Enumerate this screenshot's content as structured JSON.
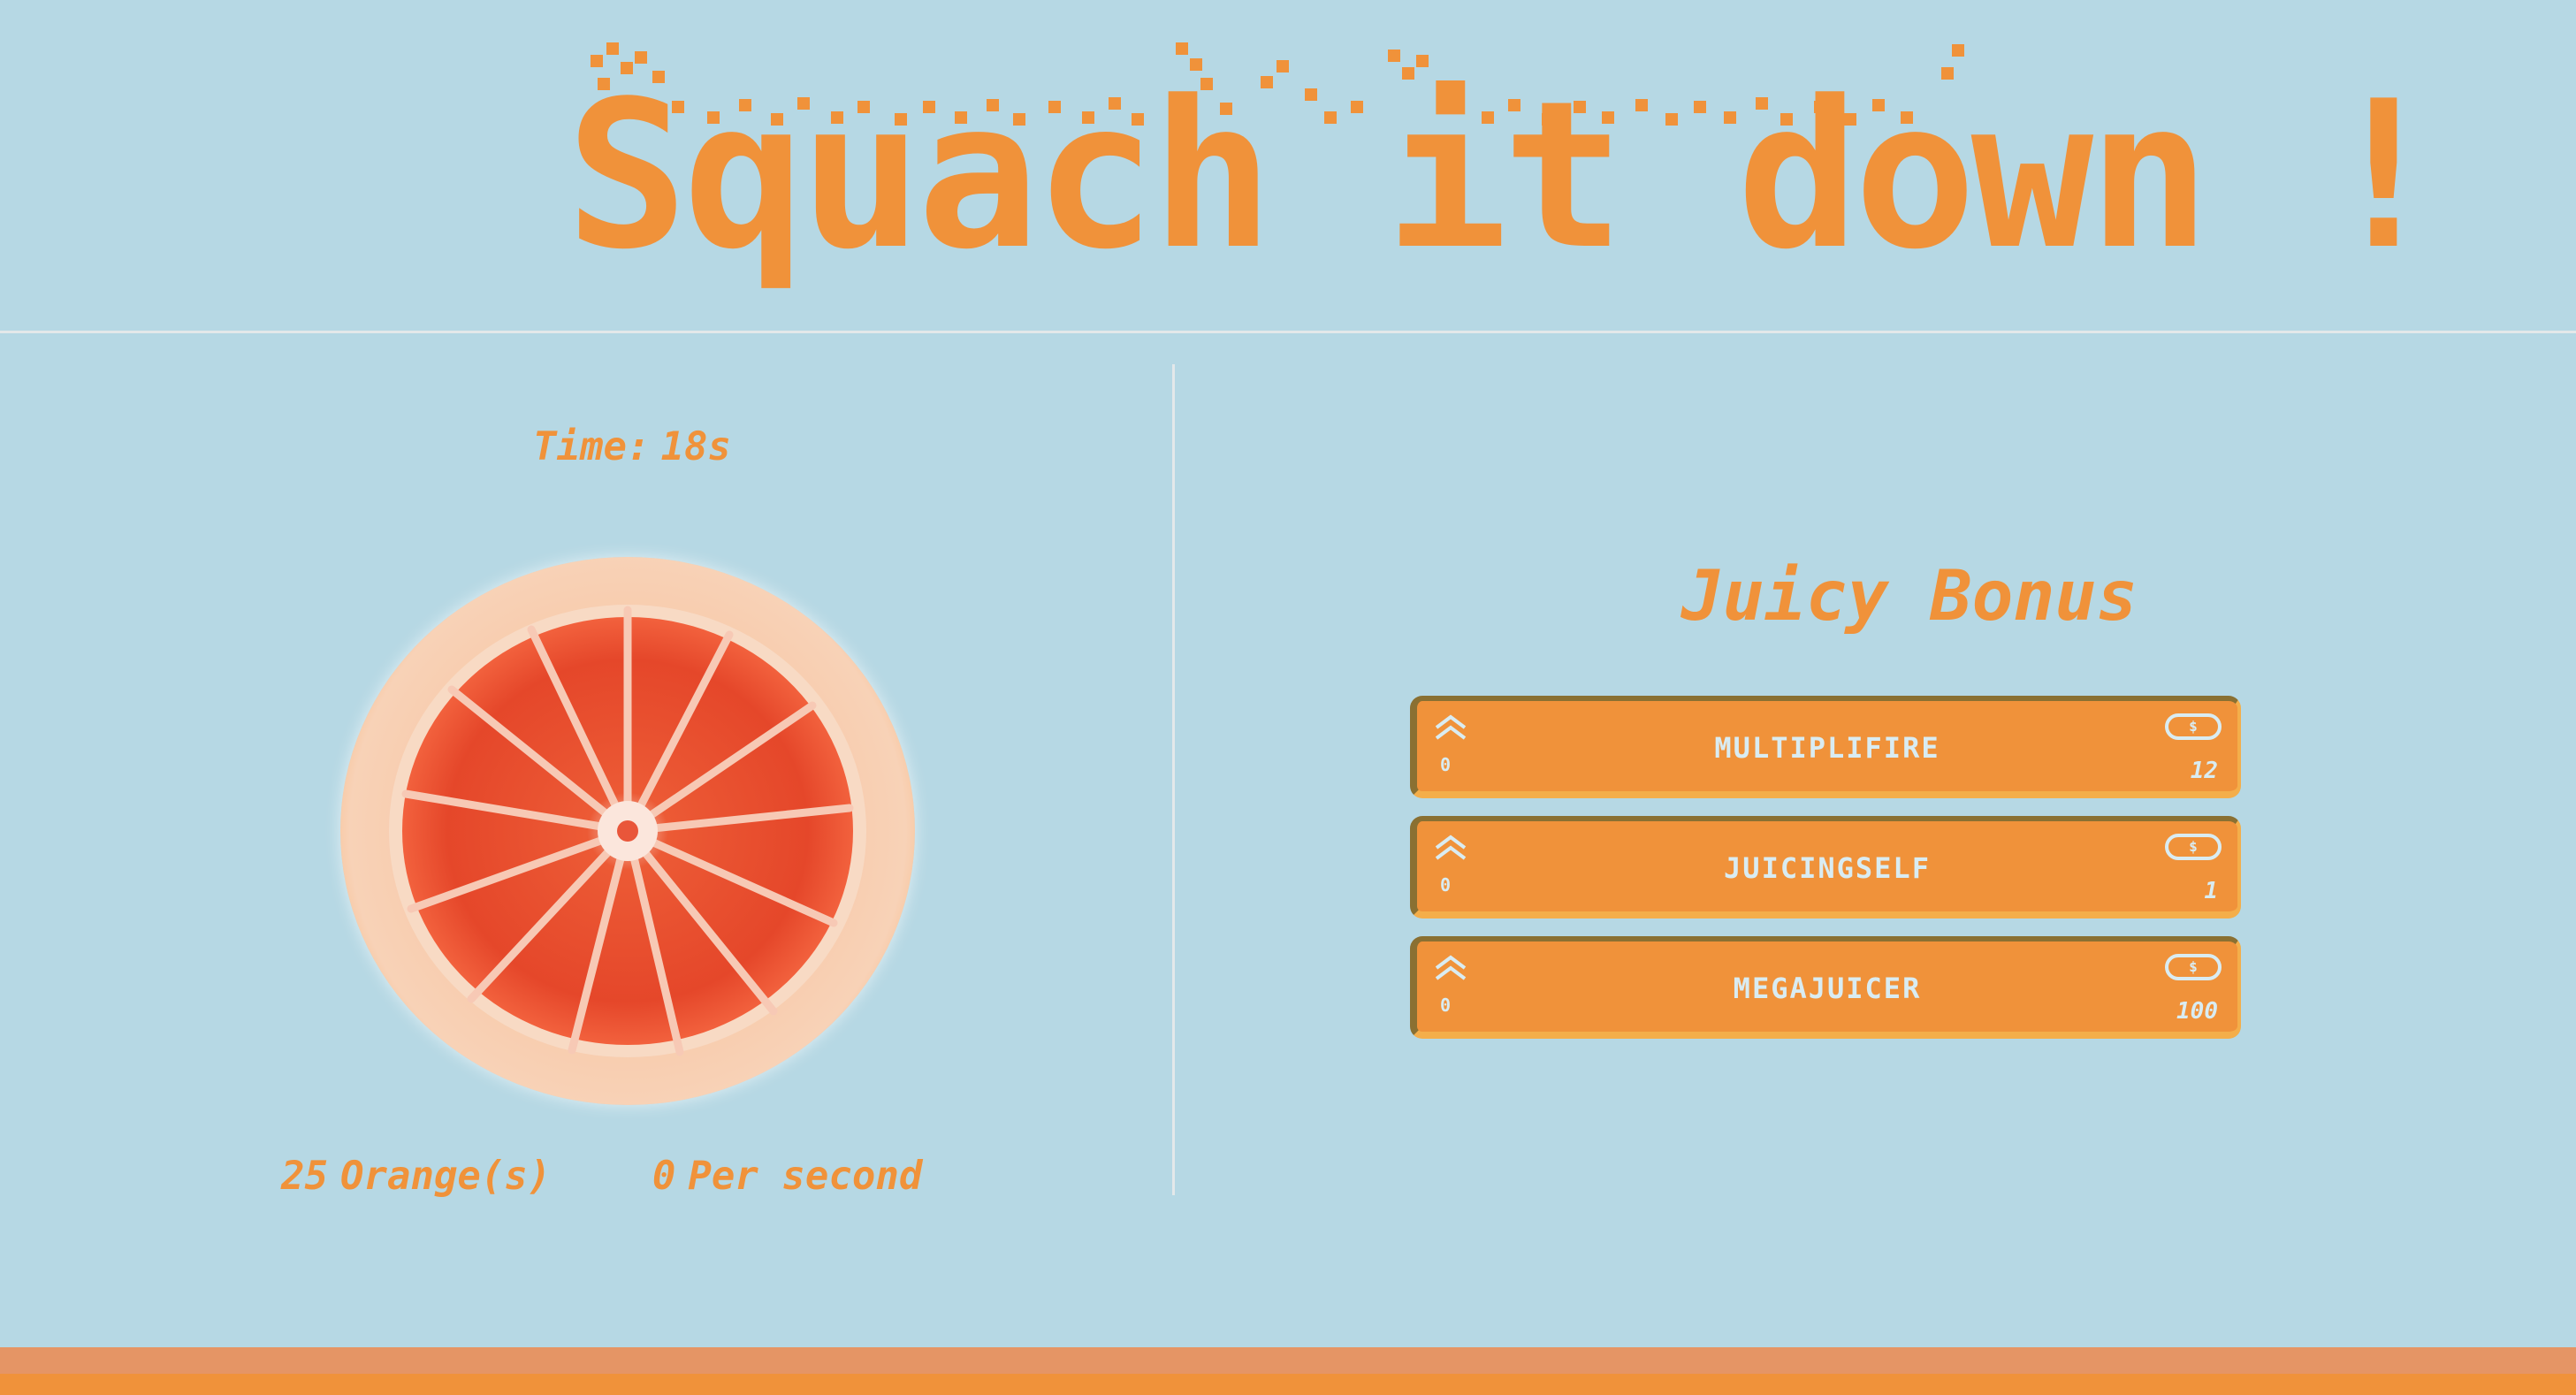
{
  "header": {
    "title": "Squach it down !"
  },
  "game": {
    "timer_label": "Time:",
    "timer_value": "18s",
    "oranges_count": "25",
    "oranges_label": "Orange(s)",
    "per_second_count": "0",
    "per_second_label": "Per second"
  },
  "bonus": {
    "title": "Juicy Bonus",
    "currency_icon": "$",
    "items": [
      {
        "name": "MULTIPLIFIRE",
        "level": "0",
        "cost": "12"
      },
      {
        "name": "JUICINGSELF",
        "level": "0",
        "cost": "1"
      },
      {
        "name": "MEGAJUICER",
        "level": "0",
        "cost": "100"
      }
    ]
  },
  "colors": {
    "background": "#b6d8e4",
    "accent_orange": "#f0923a",
    "card_shadow": "#8a7032",
    "footer_light": "#e59565"
  },
  "icons": {
    "upgrade": "double-chevron-up-icon",
    "currency": "coin-icon",
    "orange": "grapefruit-slice-image"
  }
}
